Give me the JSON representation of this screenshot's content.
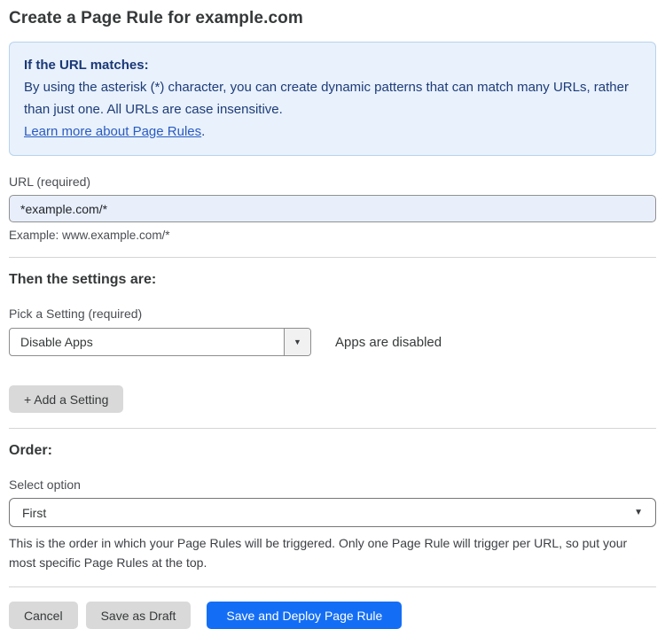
{
  "page": {
    "title": "Create a Page Rule for example.com"
  },
  "info_box": {
    "heading": "If the URL matches:",
    "body": "By using the asterisk (*) character, you can create dynamic patterns that can match many URLs, rather than just one. All URLs are case insensitive.",
    "link_label": "Learn more about Page Rules",
    "link_suffix": "."
  },
  "url_field": {
    "label": "URL (required)",
    "value": "*example.com/*",
    "example": "Example: www.example.com/*"
  },
  "settings_section": {
    "heading": "Then the settings are:",
    "setting_label": "Pick a Setting (required)",
    "setting_value": "Disable Apps",
    "setting_status": "Apps are disabled",
    "add_setting_label": "+ Add a Setting"
  },
  "order_section": {
    "heading": "Order:",
    "select_label": "Select option",
    "select_value": "First",
    "help_text": "This is the order in which your Page Rules will be triggered. Only one Page Rule will trigger per URL, so put your most specific Page Rules at the top."
  },
  "footer": {
    "cancel_label": "Cancel",
    "save_draft_label": "Save as Draft",
    "save_deploy_label": "Save and Deploy Page Rule"
  },
  "icons": {
    "dropdown_caret": "▼"
  },
  "colors": {
    "primary_button": "#146ef5",
    "gray_button": "#d9d9d9",
    "info_background": "#e8f1fc",
    "info_border": "#b9d3ef",
    "info_text": "#1e3c78",
    "link": "#2a5bbf",
    "input_background": "#e8effb"
  }
}
